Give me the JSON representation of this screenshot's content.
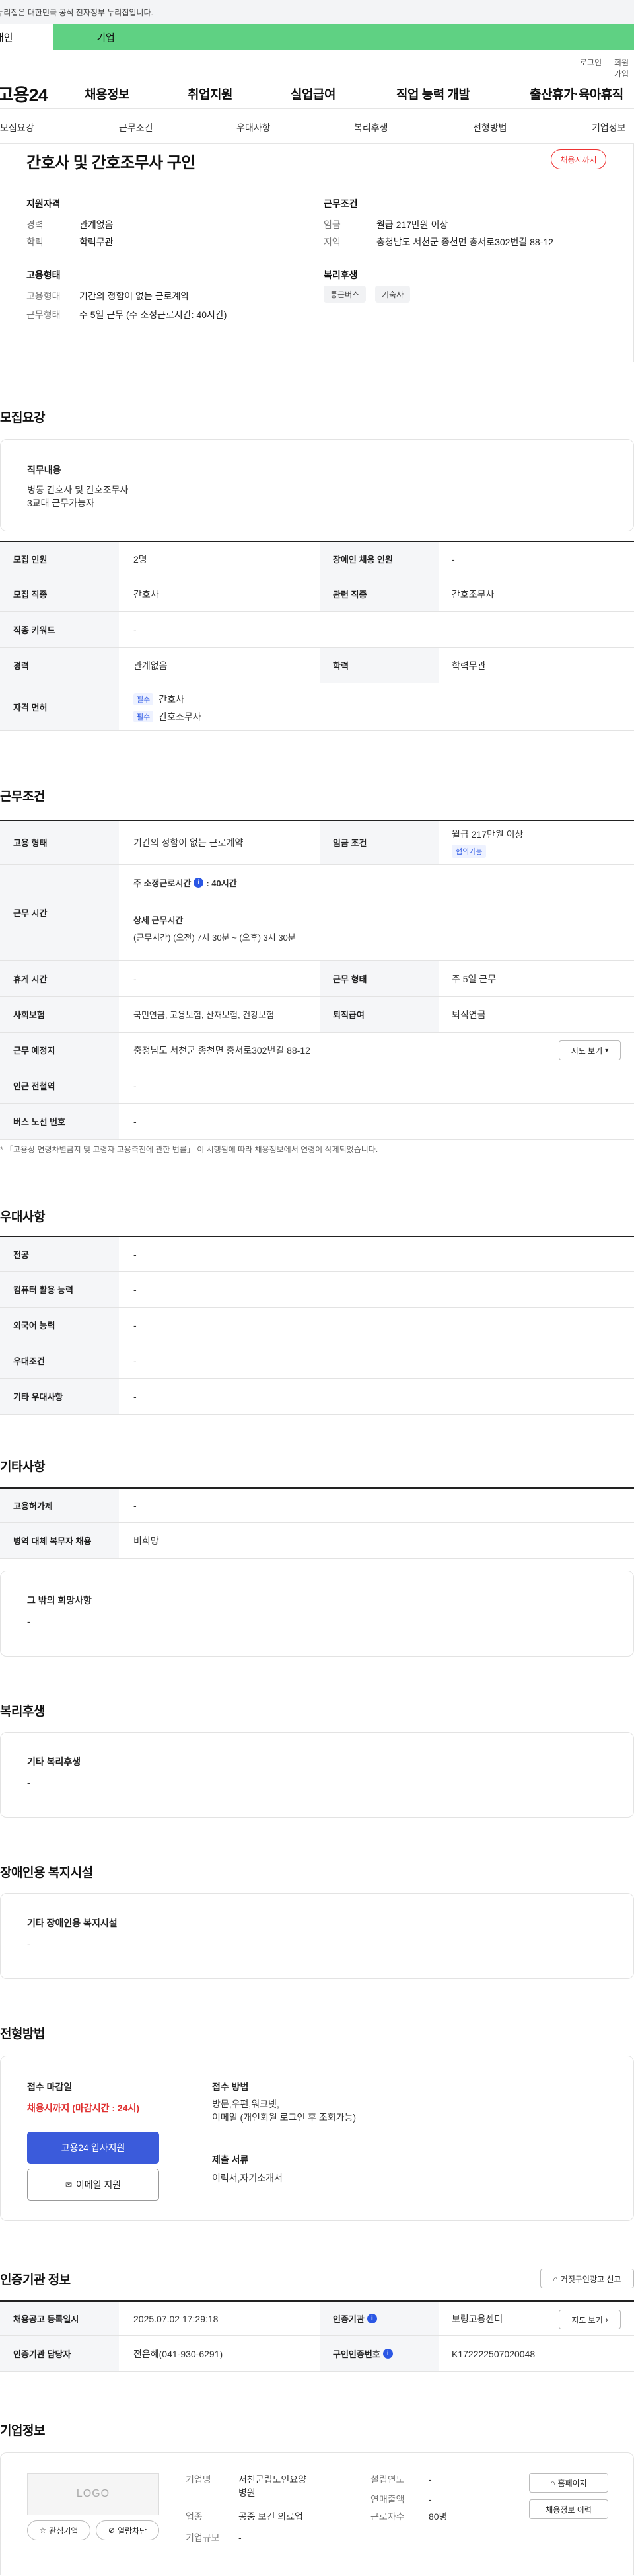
{
  "gov_notice": "이 누리집은 대한민국 공식 전자정부 누리집입니다.",
  "top_tabs": {
    "personal": "개인",
    "company": "기업"
  },
  "util": {
    "login": "로그인",
    "signup": "회원가입"
  },
  "gnb": {
    "logo": "고용24",
    "menu": [
      "채용정보",
      "취업지원",
      "실업급여",
      "직업 능력 개발",
      "출산휴가·육아휴직"
    ]
  },
  "subnav": [
    "모집요강",
    "근무조건",
    "우대사항",
    "복리후생",
    "전형방법",
    "기업정보"
  ],
  "summary": {
    "title": "간호사 및 간호조무사 구인",
    "deadline_badge": "채용시까지",
    "qual_heading": "지원자격",
    "career_label": "경력",
    "career_value": "관계없음",
    "edu_label": "학력",
    "edu_value": "학력무관",
    "emp_heading": "고용형태",
    "emptype_label": "고용형태",
    "emptype_value": "기간의 정함이 없는 근로계약",
    "worktype_label": "근무형태",
    "worktype_value": "주 5일 근무 (주 소정근로시간: 40시간)",
    "cond_heading": "근무조건",
    "wage_label": "임금",
    "wage_value": "월급 217만원 이상",
    "region_label": "지역",
    "region_value": "충청남도 서천군 종천면 충서로302번길 88-12",
    "welfare_heading": "복리후생",
    "welfare_chips": [
      "통근버스",
      "기숙사"
    ]
  },
  "recruit": {
    "title": "모집요강",
    "duty_heading": "직무내용",
    "duty_text": "병동 간호사 및 간호조무사\n3교대 근무가능자",
    "rows": {
      "count_label": "모집 인원",
      "count_value": "2명",
      "disabled_label": "장애인 채용 인원",
      "disabled_value": "-",
      "job_label": "모집 직종",
      "job_value": "간호사",
      "related_label": "관련 직종",
      "related_value": "간호조무사",
      "keyword_label": "직종 키워드",
      "keyword_value": "-",
      "career_label": "경력",
      "career_value": "관계없음",
      "edu_label": "학력",
      "edu_value": "학력무관",
      "license_label": "자격 면허",
      "license_tag": "필수",
      "license_1": "간호사",
      "license_2": "간호조무사"
    }
  },
  "work": {
    "title": "근무조건",
    "emptype_label": "고용 형태",
    "emptype_value": "기간의 정함이 없는 근로계약",
    "wage_label": "임금 조건",
    "wage_value": "월급 217만원 이상",
    "wage_tag": "협의가능",
    "hours_label": "근무 시간",
    "hours_week": "주 소정근로시간",
    "hours_week_value": ": 40시간",
    "hours_detail_heading": "상세 근무시간",
    "hours_detail": "(근무시간) (오전) 7시 30분 ~ (오후) 3시 30분",
    "rest_label": "휴게 시간",
    "rest_value": "-",
    "form_label": "근무 형태",
    "form_value": "주 5일 근무",
    "insurance_label": "사회보험",
    "insurance_value": "국민연금, 고용보험, 산재보험, 건강보험",
    "severance_label": "퇴직급여",
    "severance_value": "퇴직연금",
    "place_label": "근무 예정지",
    "place_value": "충청남도 서천군 종천면 충서로302번길 88-12",
    "map_btn": "지도 보기",
    "subway_label": "인근 전철역",
    "subway_value": "-",
    "bus_label": "버스 노선 번호",
    "bus_value": "-",
    "note": "* 「고용상 연령차별금지 및 고령자 고용촉진에 관한 법률」 이 시행됨에 따라 채용정보에서 연령이 삭제되었습니다."
  },
  "prefer": {
    "title": "우대사항",
    "rows": [
      {
        "label": "전공",
        "value": "-"
      },
      {
        "label": "컴퓨터 활용 능력",
        "value": "-"
      },
      {
        "label": "외국어 능력",
        "value": "-"
      },
      {
        "label": "우대조건",
        "value": "-"
      },
      {
        "label": "기타 우대사항",
        "value": "-"
      }
    ]
  },
  "etc": {
    "title": "기타사항",
    "rows": [
      {
        "label": "고용허가제",
        "value": "-"
      },
      {
        "label": "병역 대체 복무자 채용",
        "value": "비희망"
      }
    ],
    "other_heading": "그 밖의 희망사항",
    "other_value": "-"
  },
  "welfare": {
    "title": "복리후생",
    "heading": "기타 복리후생",
    "value": "-"
  },
  "disabled_fac": {
    "title": "장애인용 복지시설",
    "heading": "기타 장애인용 복지시설",
    "value": "-"
  },
  "selection": {
    "title": "전형방법",
    "deadline_heading": "접수 마감일",
    "deadline_value": "채용시까지 (마감시간 : 24시)",
    "apply_btn": "고용24 입사지원",
    "email_btn": "이메일 지원",
    "method_heading": "접수 방법",
    "method_value": "방문,우편,워크넷,\n이메일 (개인회원 로그인 후 조회가능)",
    "docs_heading": "제출 서류",
    "docs_value": "이력서,자기소개서"
  },
  "cert": {
    "title": "인증기관 정보",
    "report_btn": "거짓구인광고 신고",
    "reg_label": "채용공고 등록일시",
    "reg_value": "2025.07.02 17:29:18",
    "agency_label": "인증기관",
    "agency_value": "보령고용센터",
    "view_btn": "지도 보기",
    "manager_label": "인증기관 담당자",
    "manager_value": "전은혜(041-930-6291)",
    "cert_no_label": "구인인증번호",
    "cert_no_value": "K172222507020048"
  },
  "company": {
    "title": "기업정보",
    "logo_text": "LOGO",
    "interest_btn": "관심기업",
    "block_btn": "열람차단",
    "name_label": "기업명",
    "name_value": "서천군립노인요양\n병원",
    "industry_label": "업종",
    "industry_value": "공중 보건 의료업",
    "size_label": "기업규모",
    "size_value": "-",
    "year_label": "설립연도",
    "year_value": "-",
    "sales_label": "연매출액",
    "sales_value": "-",
    "employees_label": "근로자수",
    "employees_value": "80명",
    "homepage_btn": "홈페이지",
    "history_btn": "채용정보 이력"
  }
}
